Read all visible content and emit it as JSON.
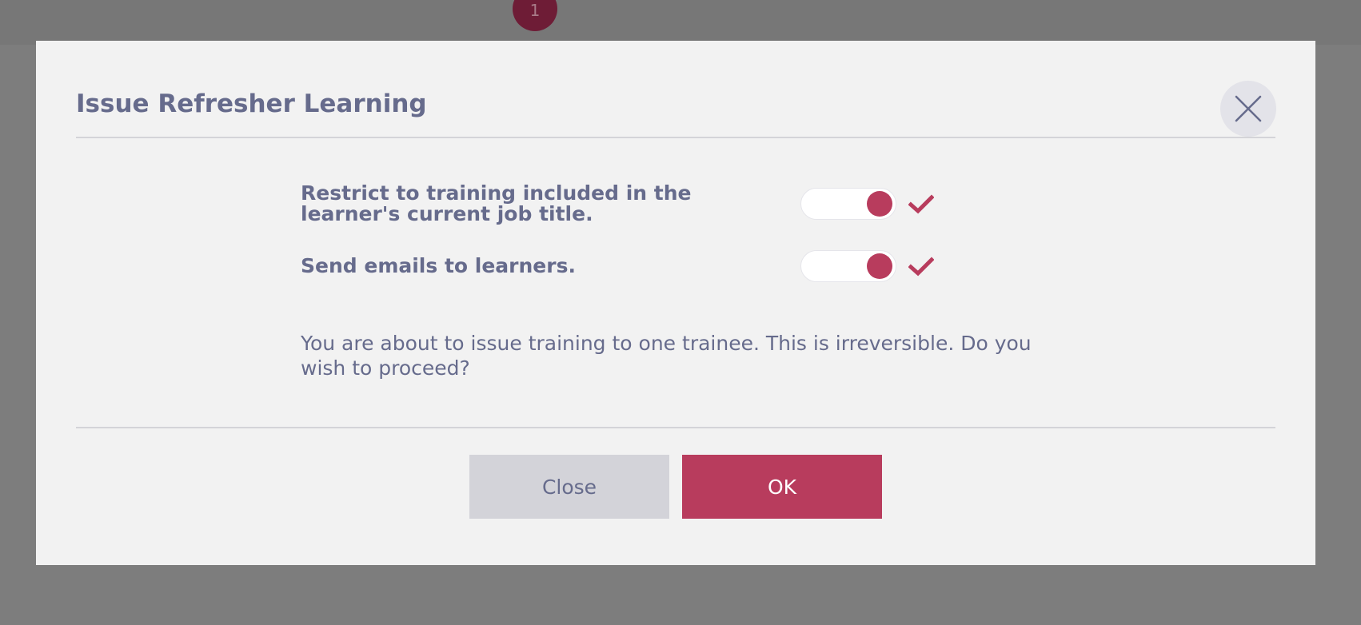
{
  "background": {
    "step_badge": "1"
  },
  "modal": {
    "title": "Issue Refresher Learning",
    "close_icon": "close-icon",
    "options": [
      {
        "label": "Restrict to training included in the learner's current job title.",
        "enabled": true
      },
      {
        "label": "Send emails to learners.",
        "enabled": true
      }
    ],
    "message": "You are about to issue training to one trainee. This is irreversible. Do you wish to proceed?",
    "buttons": {
      "close_label": "Close",
      "ok_label": "OK"
    }
  },
  "colors": {
    "accent": "#b83c5d",
    "text": "#666b8c",
    "modal_bg": "#f2f2f2",
    "overlay": "#7d7d7d"
  }
}
